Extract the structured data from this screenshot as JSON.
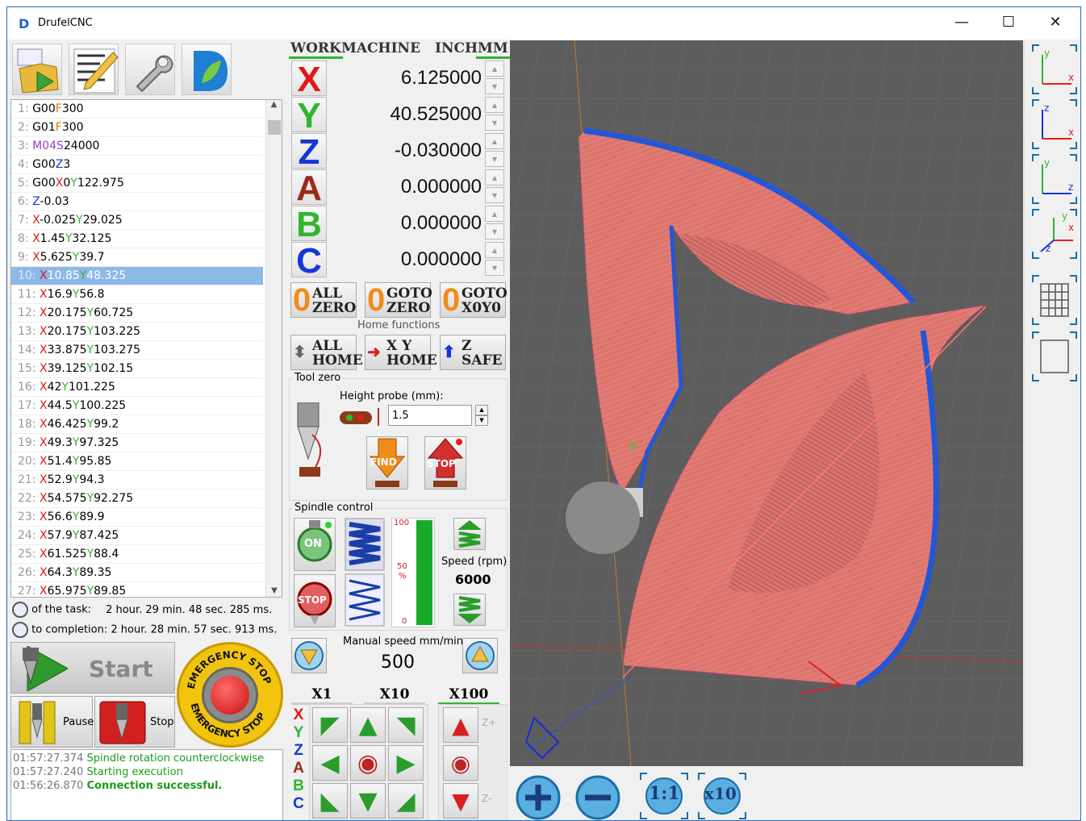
{
  "app": {
    "title": "DrufelCNC"
  },
  "window_controls": {
    "minimize": "—",
    "maximize": "☐",
    "close": "✕"
  },
  "toolbar": {
    "open_icon_text": "G00 X1Y2 F8\nG01 Z3\nG01 X1",
    "edit_icon_text": "G00 X1Y2 8\nG01 Z2\nG01 7\nG0 38\nG 1 F300"
  },
  "gcode": {
    "lines": [
      {
        "n": "1:",
        "parts": [
          [
            "G00",
            ""
          ],
          [
            "F",
            "F"
          ],
          [
            "300",
            ""
          ]
        ]
      },
      {
        "n": "2:",
        "parts": [
          [
            "G01",
            ""
          ],
          [
            "F",
            "F"
          ],
          [
            "300",
            ""
          ]
        ]
      },
      {
        "n": "3:",
        "parts": [
          [
            "M04",
            "M"
          ],
          [
            "S",
            "S"
          ],
          [
            "24000",
            ""
          ]
        ]
      },
      {
        "n": "4:",
        "parts": [
          [
            "G00",
            ""
          ],
          [
            "Z",
            "Z"
          ],
          [
            "3",
            ""
          ]
        ]
      },
      {
        "n": "5:",
        "parts": [
          [
            "G00",
            ""
          ],
          [
            "X",
            "X"
          ],
          [
            "0",
            ""
          ],
          [
            "Y",
            "Y"
          ],
          [
            "122.975",
            ""
          ]
        ]
      },
      {
        "n": "6:",
        "parts": [
          [
            "Z",
            "Z"
          ],
          [
            "-0.03",
            ""
          ]
        ]
      },
      {
        "n": "7:",
        "parts": [
          [
            "X",
            "X"
          ],
          [
            "-0.025",
            ""
          ],
          [
            "Y",
            "Y"
          ],
          [
            "29.025",
            ""
          ]
        ]
      },
      {
        "n": "8:",
        "parts": [
          [
            "X",
            "X"
          ],
          [
            "1.45",
            ""
          ],
          [
            "Y",
            "Y"
          ],
          [
            "32.125",
            ""
          ]
        ]
      },
      {
        "n": "9:",
        "parts": [
          [
            "X",
            "X"
          ],
          [
            "5.625",
            ""
          ],
          [
            "Y",
            "Y"
          ],
          [
            "39.7",
            ""
          ]
        ]
      },
      {
        "n": "10:",
        "parts": [
          [
            "X",
            "X"
          ],
          [
            "10.85",
            ""
          ],
          [
            "Y",
            "Y"
          ],
          [
            "48.325",
            ""
          ]
        ],
        "selected": true
      },
      {
        "n": "11:",
        "parts": [
          [
            "X",
            "X"
          ],
          [
            "16.9",
            ""
          ],
          [
            "Y",
            "Y"
          ],
          [
            "56.8",
            ""
          ]
        ]
      },
      {
        "n": "12:",
        "parts": [
          [
            "X",
            "X"
          ],
          [
            "20.175",
            ""
          ],
          [
            "Y",
            "Y"
          ],
          [
            "60.725",
            ""
          ]
        ]
      },
      {
        "n": "13:",
        "parts": [
          [
            "X",
            "X"
          ],
          [
            "20.175",
            ""
          ],
          [
            "Y",
            "Y"
          ],
          [
            "103.225",
            ""
          ]
        ]
      },
      {
        "n": "14:",
        "parts": [
          [
            "X",
            "X"
          ],
          [
            "33.875",
            ""
          ],
          [
            "Y",
            "Y"
          ],
          [
            "103.275",
            ""
          ]
        ]
      },
      {
        "n": "15:",
        "parts": [
          [
            "X",
            "X"
          ],
          [
            "39.125",
            ""
          ],
          [
            "Y",
            "Y"
          ],
          [
            "102.15",
            ""
          ]
        ]
      },
      {
        "n": "16:",
        "parts": [
          [
            "X",
            "X"
          ],
          [
            "42",
            ""
          ],
          [
            "Y",
            "Y"
          ],
          [
            "101.225",
            ""
          ]
        ]
      },
      {
        "n": "17:",
        "parts": [
          [
            "X",
            "X"
          ],
          [
            "44.5",
            ""
          ],
          [
            "Y",
            "Y"
          ],
          [
            "100.225",
            ""
          ]
        ]
      },
      {
        "n": "18:",
        "parts": [
          [
            "X",
            "X"
          ],
          [
            "46.425",
            ""
          ],
          [
            "Y",
            "Y"
          ],
          [
            "99.2",
            ""
          ]
        ]
      },
      {
        "n": "19:",
        "parts": [
          [
            "X",
            "X"
          ],
          [
            "49.3",
            ""
          ],
          [
            "Y",
            "Y"
          ],
          [
            "97.325",
            ""
          ]
        ]
      },
      {
        "n": "20:",
        "parts": [
          [
            "X",
            "X"
          ],
          [
            "51.4",
            ""
          ],
          [
            "Y",
            "Y"
          ],
          [
            "95.85",
            ""
          ]
        ]
      },
      {
        "n": "21:",
        "parts": [
          [
            "X",
            "X"
          ],
          [
            "52.9",
            ""
          ],
          [
            "Y",
            "Y"
          ],
          [
            "94.3",
            ""
          ]
        ]
      },
      {
        "n": "22:",
        "parts": [
          [
            "X",
            "X"
          ],
          [
            "54.575",
            ""
          ],
          [
            "Y",
            "Y"
          ],
          [
            "92.275",
            ""
          ]
        ]
      },
      {
        "n": "23:",
        "parts": [
          [
            "X",
            "X"
          ],
          [
            "56.6",
            ""
          ],
          [
            "Y",
            "Y"
          ],
          [
            "89.9",
            ""
          ]
        ]
      },
      {
        "n": "24:",
        "parts": [
          [
            "X",
            "X"
          ],
          [
            "57.9",
            ""
          ],
          [
            "Y",
            "Y"
          ],
          [
            "87.425",
            ""
          ]
        ]
      },
      {
        "n": "25:",
        "parts": [
          [
            "X",
            "X"
          ],
          [
            "61.525",
            ""
          ],
          [
            "Y",
            "Y"
          ],
          [
            "88.4",
            ""
          ]
        ]
      },
      {
        "n": "26:",
        "parts": [
          [
            "X",
            "X"
          ],
          [
            "64.3",
            ""
          ],
          [
            "Y",
            "Y"
          ],
          [
            "89.35",
            ""
          ]
        ]
      },
      {
        "n": "27:",
        "parts": [
          [
            "X",
            "X"
          ],
          [
            "65.975",
            ""
          ],
          [
            "Y",
            "Y"
          ],
          [
            "89.85",
            ""
          ]
        ]
      }
    ]
  },
  "timing": {
    "task_label": "of the task:",
    "task_value": "2 hour. 29 min. 48 sec. 285 ms.",
    "completion_label": "to completion:",
    "completion_value": "2 hour. 28 min. 57 sec. 913 ms."
  },
  "controls": {
    "start": "Start",
    "pause": "Pause",
    "stop": "Stop",
    "estop_top": "EMERGENCY STOP",
    "estop_bottom": "EMERGENCY STOP"
  },
  "log": [
    {
      "time": "01:57:27.374",
      "msg": "Spindle rotation counterclockwise",
      "bold": false
    },
    {
      "time": "01:57:27.240",
      "msg": "Starting execution",
      "bold": false
    },
    {
      "time": "01:56:26.870",
      "msg": "Connection successful.",
      "bold": true
    }
  ],
  "coords": {
    "tabs": {
      "work": "WORK",
      "machine": "MACHINE",
      "inch": "INCH",
      "mm": "MM"
    },
    "axes": [
      {
        "letter": "X",
        "value": "6.125000",
        "color": "#e01818"
      },
      {
        "letter": "Y",
        "value": "40.525000",
        "color": "#2fb52f"
      },
      {
        "letter": "Z",
        "value": "-0.030000",
        "color": "#1536d8"
      },
      {
        "letter": "A",
        "value": "0.000000",
        "color": "#9b2a1a"
      },
      {
        "letter": "B",
        "value": "0.000000",
        "color": "#2fb52f"
      },
      {
        "letter": "C",
        "value": "0.000000",
        "color": "#1536d8"
      }
    ]
  },
  "home": {
    "all_zero": "ALL\nZERO",
    "goto_zero": "GOTO\nZERO",
    "goto_x0y0": "GOTO\nX0Y0",
    "group_label": "Home functions",
    "all_home": "ALL\nHOME",
    "xy_home": "X Y\nHOME",
    "z_safe": "Z\nSAFE"
  },
  "toolzero": {
    "group_label": "Tool zero",
    "probe_label": "Height probe (mm):",
    "probe_value": "1.5",
    "find": "FIND",
    "stop": "STOP"
  },
  "spindle": {
    "group_label": "Spindle control",
    "on": "ON",
    "stop": "STOP",
    "gauge_max": "100",
    "gauge_mid": "50",
    "gauge_pct": "%",
    "gauge_min": "0",
    "gauge_fill": 1.0,
    "speed_label": "Speed (rpm)",
    "speed_value": "6000"
  },
  "jog": {
    "manual_label": "Manual speed mm/min",
    "manual_value": "500",
    "mult": [
      "X1",
      "X10",
      "X100"
    ],
    "active_mult": "X100",
    "axes_letters": [
      "X",
      "Y",
      "Z",
      "A",
      "B",
      "C"
    ],
    "zplus": "Z+",
    "zminus": "Z-"
  },
  "view": {
    "tool_labels": [
      "y x",
      "z x",
      "y z",
      "y x z",
      "grid",
      "frame"
    ],
    "zoom_11": "1:1",
    "zoom_x10": "x10"
  },
  "colors": {
    "toolpath": "#e07b74",
    "border": "#2456d6",
    "grid_bg": "#5d5d5d",
    "accent": "#2fb52f"
  }
}
